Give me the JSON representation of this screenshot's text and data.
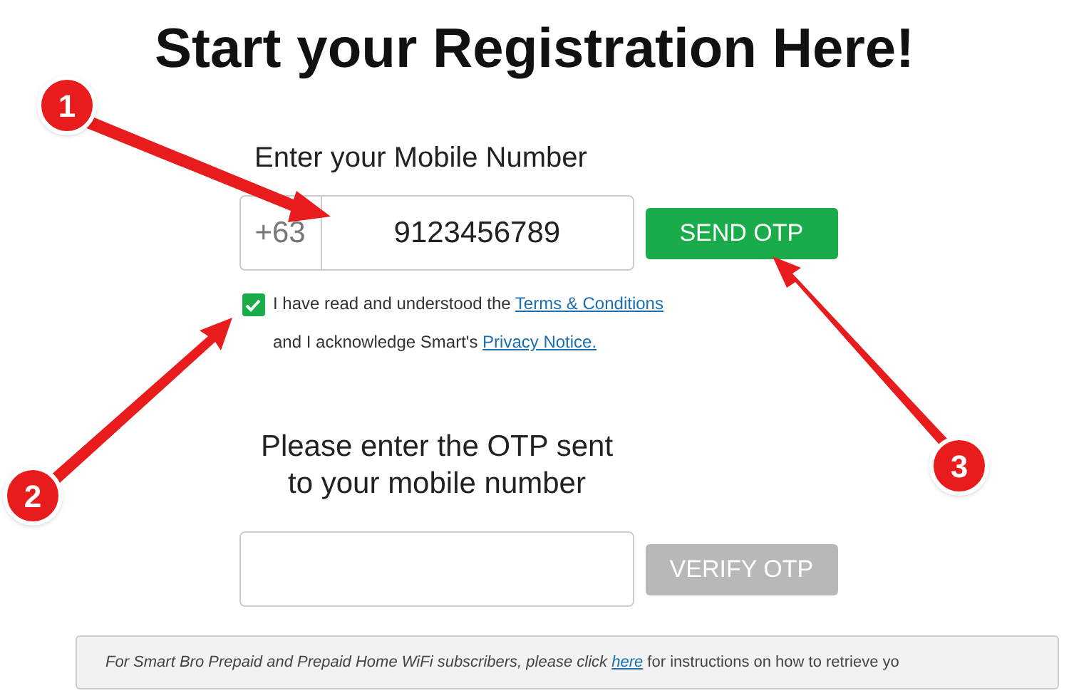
{
  "title": "Start your Registration Here!",
  "mobile": {
    "label": "Enter your Mobile Number",
    "prefix": "+63",
    "value": "9123456789",
    "button": "SEND OTP"
  },
  "consent": {
    "checked": true,
    "line_1": "I have read and understood the",
    "terms_link": "Terms & Conditions",
    "line_2": "and I acknowledge Smart's",
    "privacy_link": "Privacy Notice."
  },
  "otp": {
    "prompt_lines": [
      "Please enter the OTP sent",
      "to your mobile number"
    ],
    "button": "VERIFY OTP",
    "disabled": true
  },
  "notice": {
    "before": "For Smart Bro Prepaid and Prepaid Home WiFi subscribers, please click",
    "link": "here",
    "after": "for instructions on how to retrieve yo"
  },
  "annotations": [
    {
      "number": "1"
    },
    {
      "number": "2"
    },
    {
      "number": "3"
    }
  ]
}
